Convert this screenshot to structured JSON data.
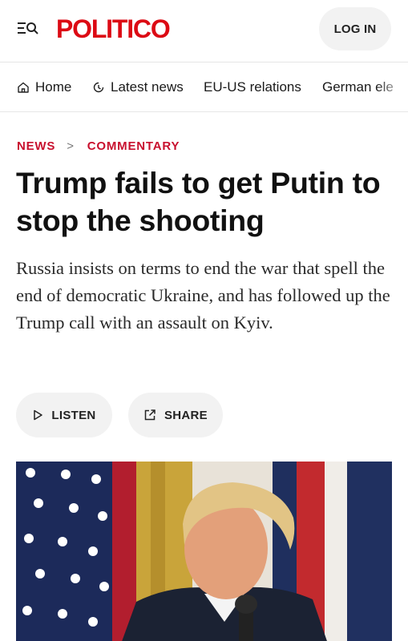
{
  "header": {
    "menu_icon": "menu-search-icon",
    "logo": "POLITICO",
    "login_label": "LOG IN"
  },
  "nav": {
    "items": [
      {
        "label": "Home",
        "icon": "home-icon"
      },
      {
        "label": "Latest news",
        "icon": "clock-icon"
      },
      {
        "label": "EU-US relations"
      },
      {
        "label": "German ele"
      }
    ]
  },
  "breadcrumb": {
    "section": "NEWS",
    "separator": ">",
    "subsection": "COMMENTARY"
  },
  "article": {
    "headline": "Trump fails to get Putin to stop the shooting",
    "dek": "Russia insists on terms to end the war that spell the end of democratic Ukraine, and has followed up the Trump call with an assault on Kyiv."
  },
  "actions": {
    "listen_label": "LISTEN",
    "share_label": "SHARE"
  },
  "colors": {
    "brand": "#dc0a14",
    "breadcrumb": "#c8102e",
    "pill_bg": "#f2f2f2"
  }
}
